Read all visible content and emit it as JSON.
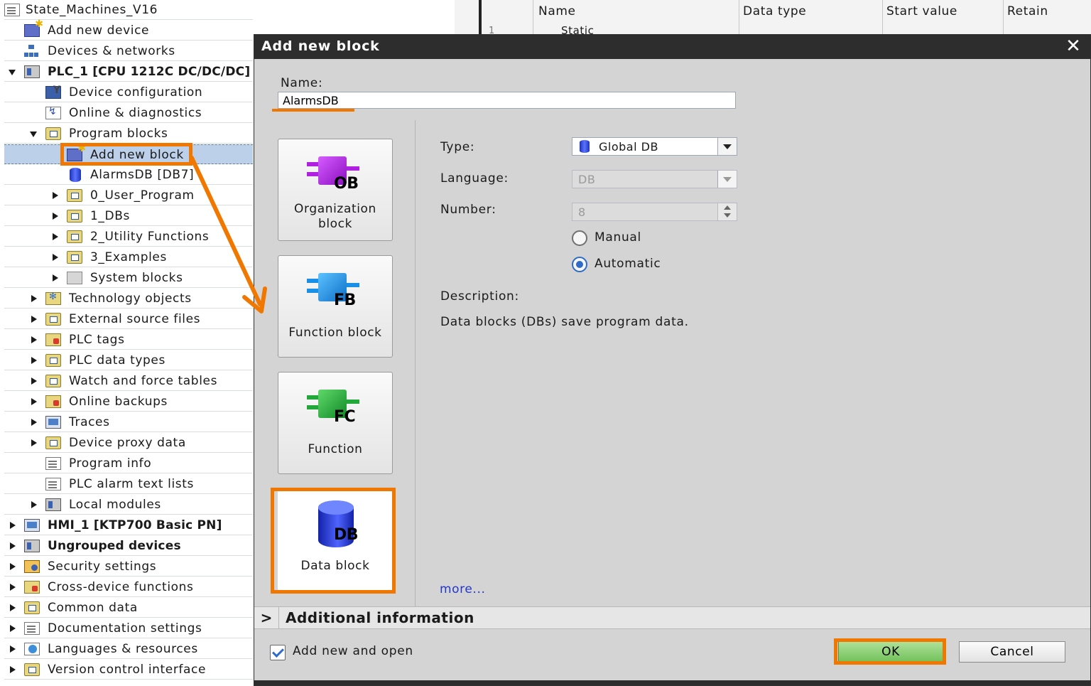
{
  "tree": {
    "items": [
      {
        "label": "State_Machines_V16",
        "icon": "project-icon"
      },
      {
        "label": "Add new device",
        "icon": "add-device-icon"
      },
      {
        "label": "Devices & networks",
        "icon": "network-icon"
      },
      {
        "label": "PLC_1 [CPU 1212C DC/DC/DC]",
        "icon": "plc-icon"
      },
      {
        "label": "Device configuration",
        "icon": "device-config-icon"
      },
      {
        "label": "Online & diagnostics",
        "icon": "diagnostics-icon"
      },
      {
        "label": "Program blocks",
        "icon": "folder-icon"
      },
      {
        "label": "Add new block",
        "icon": "add-block-icon"
      },
      {
        "label": "AlarmsDB [DB7]",
        "icon": "db-icon"
      },
      {
        "label": "0_User_Program",
        "icon": "folder-icon"
      },
      {
        "label": "1_DBs",
        "icon": "folder-icon"
      },
      {
        "label": "2_Utility Functions",
        "icon": "folder-icon"
      },
      {
        "label": "3_Examples",
        "icon": "folder-icon"
      },
      {
        "label": "System blocks",
        "icon": "folder-icon"
      },
      {
        "label": "Technology objects",
        "icon": "technology-icon"
      },
      {
        "label": "External source files",
        "icon": "folder-icon"
      },
      {
        "label": "PLC tags",
        "icon": "tags-icon"
      },
      {
        "label": "PLC data types",
        "icon": "folder-icon"
      },
      {
        "label": "Watch and force tables",
        "icon": "watch-table-icon"
      },
      {
        "label": "Online backups",
        "icon": "backup-icon"
      },
      {
        "label": "Traces",
        "icon": "trace-icon"
      },
      {
        "label": "Device proxy data",
        "icon": "proxy-icon"
      },
      {
        "label": "Program info",
        "icon": "program-info-icon"
      },
      {
        "label": "PLC alarm text lists",
        "icon": "alarm-list-icon"
      },
      {
        "label": "Local modules",
        "icon": "local-modules-icon"
      },
      {
        "label": "HMI_1 [KTP700 Basic PN]",
        "icon": "hmi-icon"
      },
      {
        "label": "Ungrouped devices",
        "icon": "ungrouped-icon"
      },
      {
        "label": "Security settings",
        "icon": "security-icon"
      },
      {
        "label": "Cross-device functions",
        "icon": "cross-device-icon"
      },
      {
        "label": "Common data",
        "icon": "common-data-icon"
      },
      {
        "label": "Documentation settings",
        "icon": "documentation-icon"
      },
      {
        "label": "Languages & resources",
        "icon": "languages-icon"
      },
      {
        "label": "Version control interface",
        "icon": "version-control-icon"
      }
    ]
  },
  "table": {
    "headers": [
      "Name",
      "Data type",
      "Start value",
      "Retain"
    ],
    "row_index": "1",
    "row_name": "Static"
  },
  "dialog": {
    "title": "Add new block",
    "name_label": "Name:",
    "name_value": "AlarmsDB",
    "blocks": [
      {
        "code": "OB",
        "label": "Organization block",
        "color": "#b020e0"
      },
      {
        "code": "FB",
        "label": "Function block",
        "color": "#1a8fe8"
      },
      {
        "code": "FC",
        "label": "Function",
        "color": "#22a83a"
      },
      {
        "code": "DB",
        "label": "Data block",
        "color": "#2a3fd8"
      }
    ],
    "type_label": "Type:",
    "type_value": "Global DB",
    "language_label": "Language:",
    "language_value": "DB",
    "number_label": "Number:",
    "number_value": "8",
    "manual_label": "Manual",
    "automatic_label": "Automatic",
    "description_label": "Description:",
    "description_text": "Data blocks (DBs) save program data.",
    "more_link": "more...",
    "additional_info": "Additional information",
    "add_new_and_open": "Add new and open",
    "ok": "OK",
    "cancel": "Cancel"
  },
  "colors": {
    "highlight": "#f07800",
    "titlebar": "#2d2d2d",
    "ok_button": "#72c15a",
    "link": "#2337c9"
  }
}
